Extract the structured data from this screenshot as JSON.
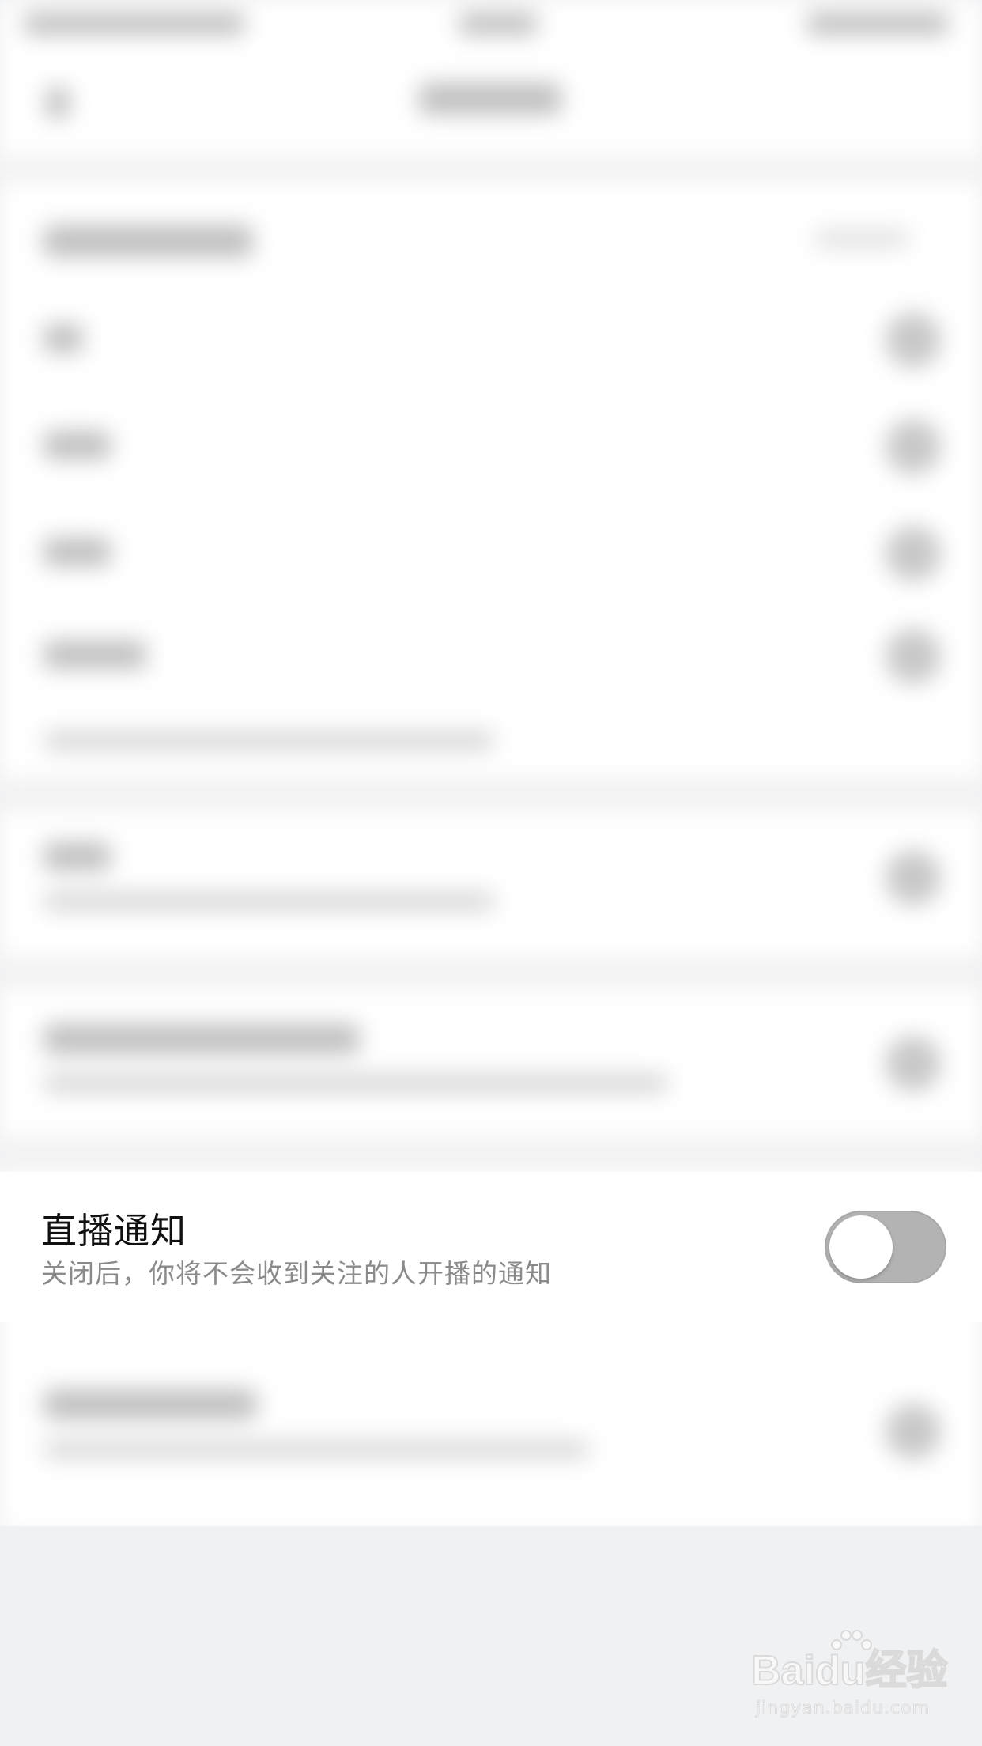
{
  "live_notification": {
    "title": "直播通知",
    "description": "关闭后，你将不会收到关注的人开播的通知",
    "toggle_on": false
  },
  "watermark": {
    "logo_text": "Baidu经验",
    "url_text": "jingyan.baidu.com"
  },
  "colors": {
    "background": "#f0f1f3",
    "toggle_off_track": "#b3b3b3",
    "title_text": "#111111",
    "description_text": "#8a8a8a"
  }
}
